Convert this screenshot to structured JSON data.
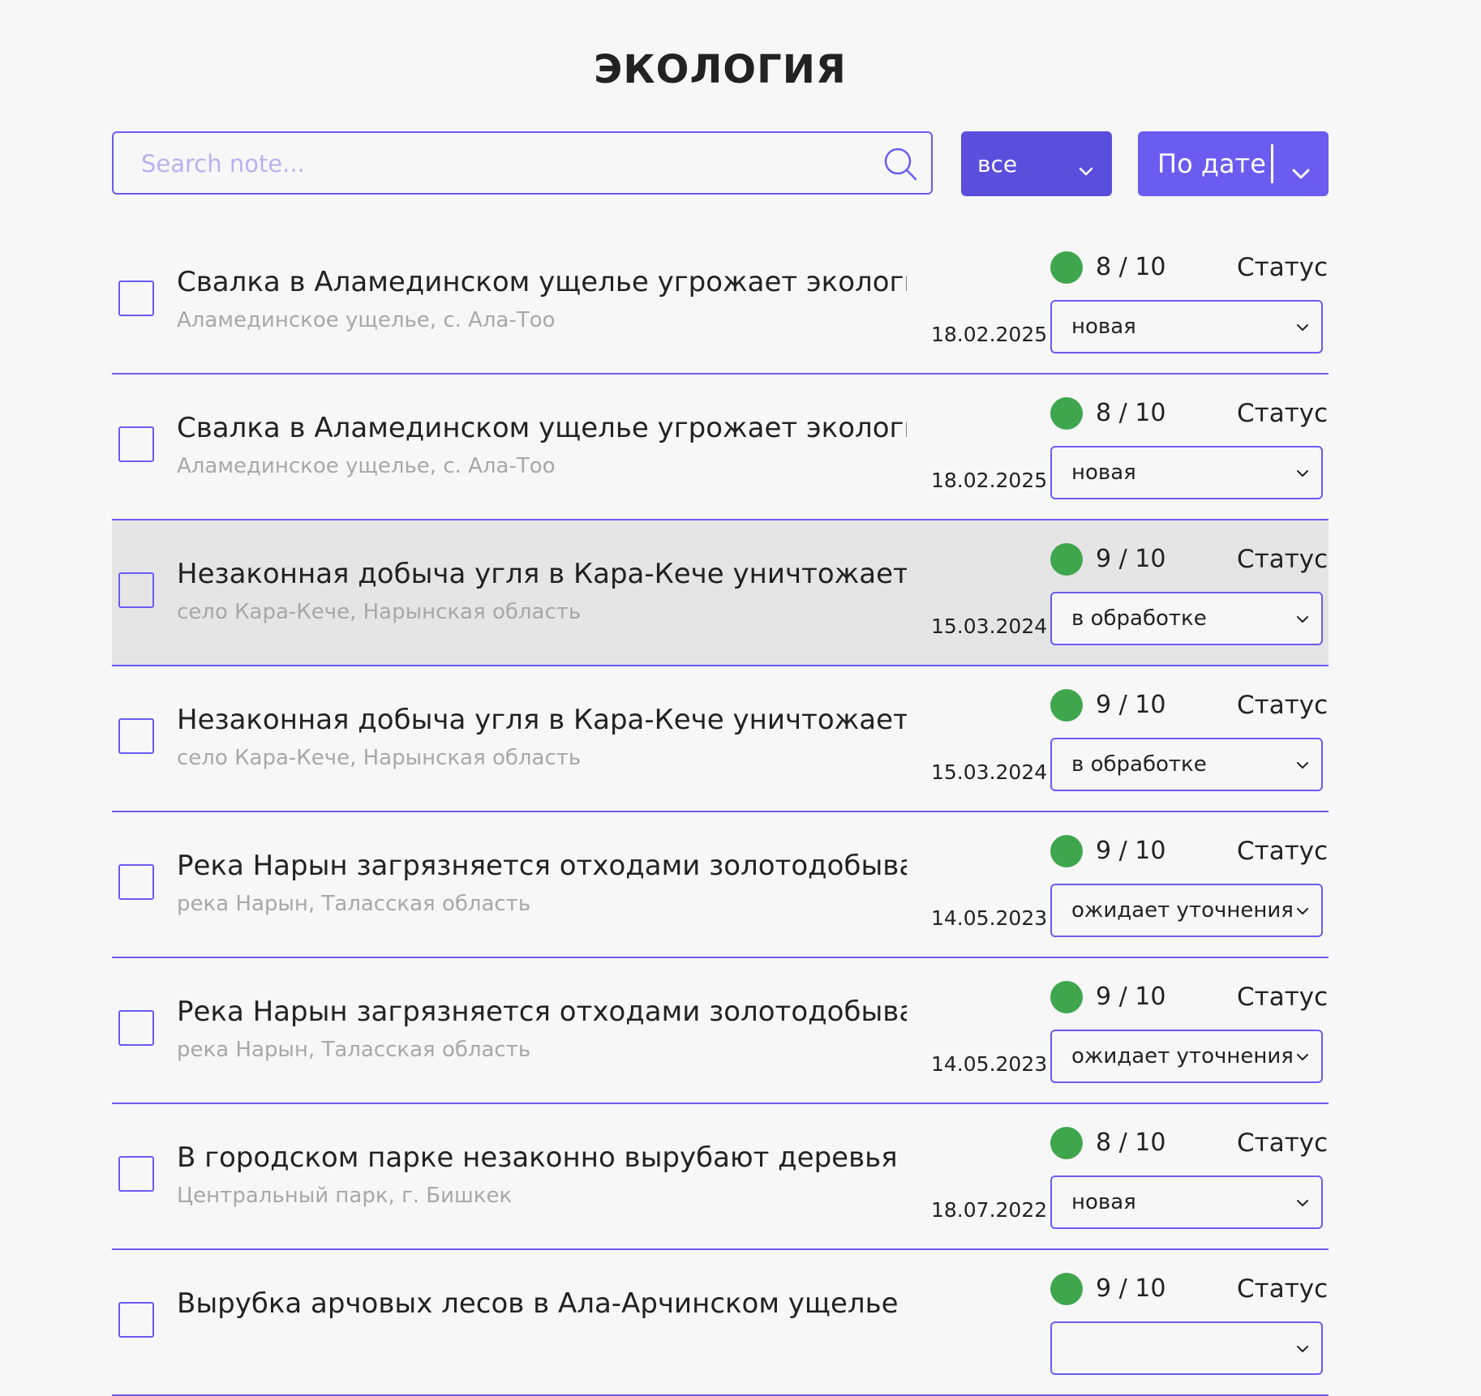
{
  "page": {
    "title": "ЭКОЛОГИЯ"
  },
  "toolbar": {
    "search_placeholder": "Search note...",
    "filter_value": "все",
    "sort_label": "По дате"
  },
  "colors": {
    "accent": "#6a5cf0",
    "filter_bg": "#5a4fdc",
    "score_dot": "#3fa64e",
    "highlight_row": "#e5e5e6"
  },
  "icons": {
    "search": "search-icon",
    "dropdown": "chevron-down-icon"
  },
  "items": [
    {
      "title": "Свалка в Аламединском ущелье угрожает экологи...",
      "location": "Аламединское ущелье, с. Ала-Тоо",
      "date": "18.02.2025",
      "score": "8 / 10",
      "status_label": "Статус",
      "status": "новая",
      "highlighted": false
    },
    {
      "title": "Свалка в Аламединском ущелье угрожает экологи...",
      "location": "Аламединское ущелье, с. Ала-Тоо",
      "date": "18.02.2025",
      "score": "8 / 10",
      "status_label": "Статус",
      "status": "новая",
      "highlighted": false
    },
    {
      "title": "Незаконная добыча угля в Кара-Кече уничтожает э...",
      "location": "село Кара-Кече, Нарынская область",
      "date": "15.03.2024",
      "score": "9 / 10",
      "status_label": "Статус",
      "status": "в обработке",
      "highlighted": true
    },
    {
      "title": "Незаконная добыча угля в Кара-Кече уничтожает э...",
      "location": "село Кара-Кече, Нарынская область",
      "date": "15.03.2024",
      "score": "9 / 10",
      "status_label": "Статус",
      "status": "в обработке",
      "highlighted": false
    },
    {
      "title": "Река Нарын загрязняется отходами золотодобыва...",
      "location": "река Нарын, Таласская область",
      "date": "14.05.2023",
      "score": "9 / 10",
      "status_label": "Статус",
      "status": "ожидает уточнения",
      "highlighted": false
    },
    {
      "title": "Река Нарын загрязняется отходами золотодобыва...",
      "location": "река Нарын, Таласская область",
      "date": "14.05.2023",
      "score": "9 / 10",
      "status_label": "Статус",
      "status": "ожидает уточнения",
      "highlighted": false
    },
    {
      "title": "В городском парке незаконно вырубают деревья д...",
      "location": "Центральный парк, г. Бишкек",
      "date": "18.07.2022",
      "score": "8 / 10",
      "status_label": "Статус",
      "status": "новая",
      "highlighted": false
    },
    {
      "title": "Вырубка арчовых лесов в Ала-Арчинском ущелье д...",
      "location": "",
      "date": "",
      "score": "9 / 10",
      "status_label": "Статус",
      "status": "",
      "highlighted": false
    }
  ]
}
